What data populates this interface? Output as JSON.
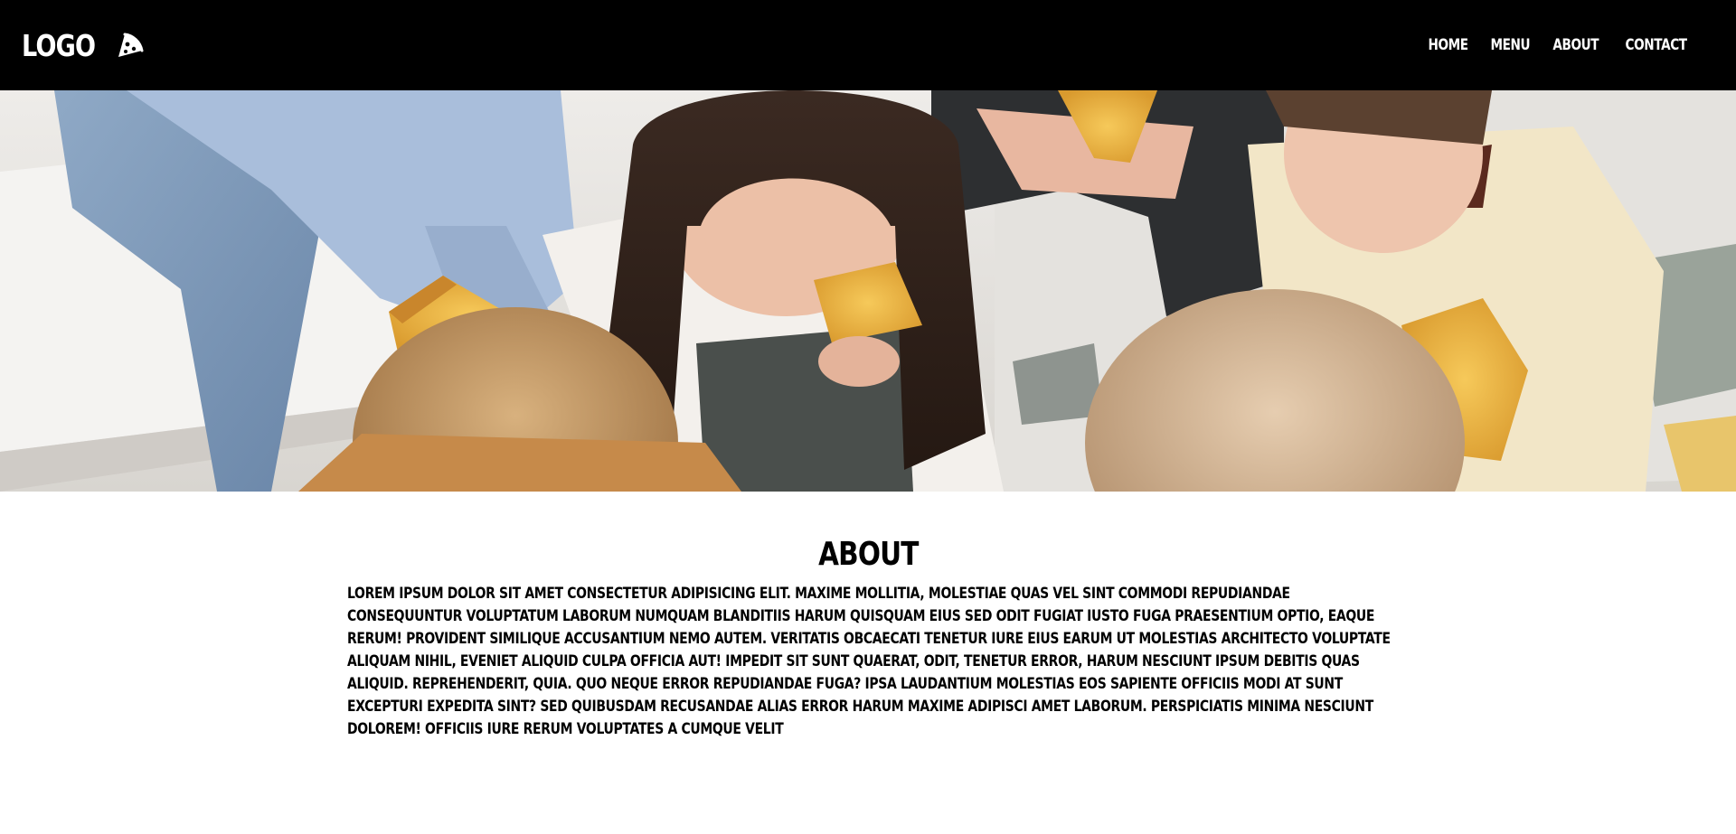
{
  "header": {
    "logo_text": "LOGO",
    "logo_icon": "pizza-icon",
    "nav": [
      {
        "label": "HOME"
      },
      {
        "label": "MENU"
      },
      {
        "label": "ABOUT"
      },
      {
        "label": "CONTACT"
      }
    ]
  },
  "hero": {
    "image_subject": "hero-photo"
  },
  "about": {
    "title": "ABOUT",
    "body": "Lorem ipsum dolor sit amet consectetur adipisicing elit. Maxime mollitia, molestiae quas vel sint commodi repudiandae consequuntur voluptatum laborum numquam blanditiis harum quisquam eius sed odit fugiat iusto fuga praesentium optio, eaque rerum! Provident similique accusantium nemo autem. Veritatis obcaecati tenetur iure eius earum ut molestias architecto voluptate aliquam nihil, eveniet aliquid culpa officia aut! Impedit sit sunt quaerat, odit, tenetur error, harum nesciunt ipsum debitis quas aliquid. Reprehenderit, quia. Quo neque error repudiandae fuga? Ipsa laudantium molestias eos sapiente officiis modi at sunt excepturi expedita sint? Sed quibusdam recusandae alias error harum maxime adipisci amet laborum. Perspiciatis minima nesciunt dolorem! Officiis iure rerum voluptates a cumque velit"
  },
  "colors": {
    "header_bg": "#000000",
    "header_text": "#ffffff",
    "page_bg": "#ffffff",
    "text": "#000000"
  }
}
